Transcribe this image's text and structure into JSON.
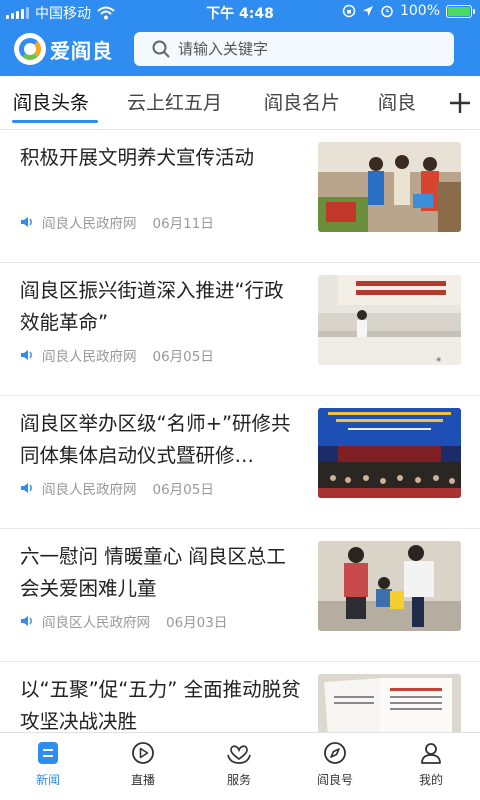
{
  "status_bar": {
    "carrier": "中国移动",
    "time": "下午 4:48",
    "battery_percent": "100%",
    "battery_level": 1.0
  },
  "header": {
    "app_name": "爱阎良",
    "search_placeholder": "请输入关键字"
  },
  "tabs": [
    {
      "label": "阎良头条",
      "active": true
    },
    {
      "label": "云上红五月",
      "active": false
    },
    {
      "label": "阎良名片",
      "active": false
    },
    {
      "label": "阎良",
      "active": false
    }
  ],
  "news": [
    {
      "title": "积极开展文明养犬宣传活动",
      "source": "阎良人民政府网",
      "date": "06月11日"
    },
    {
      "title": "阎良区振兴街道深入推进“行政效能革命”",
      "source": "阎良人民政府网",
      "date": "06月05日"
    },
    {
      "title": "阎良区举办区级“名师+”研修共同体集体启动仪式暨研修…",
      "source": "阎良人民政府网",
      "date": "06月05日"
    },
    {
      "title": "六一慰问 情暖童心 阎良区总工会关爱困难儿童",
      "source": "阎良区人民政府网",
      "date": "06月03日"
    },
    {
      "title": "以“五聚”促“五力” 全面推动脱贫攻坚决战决胜",
      "source": "",
      "date": ""
    }
  ],
  "bottom_nav": [
    {
      "label": "新闻",
      "icon": "news-icon",
      "active": true
    },
    {
      "label": "直播",
      "icon": "live-play-icon",
      "active": false
    },
    {
      "label": "服务",
      "icon": "service-heart-icon",
      "active": false
    },
    {
      "label": "阎良号",
      "icon": "compass-icon",
      "active": false
    },
    {
      "label": "我的",
      "icon": "profile-icon",
      "active": false
    }
  ],
  "colors": {
    "brand_blue": "#2f8cf0",
    "battery_green": "#4cd964"
  }
}
